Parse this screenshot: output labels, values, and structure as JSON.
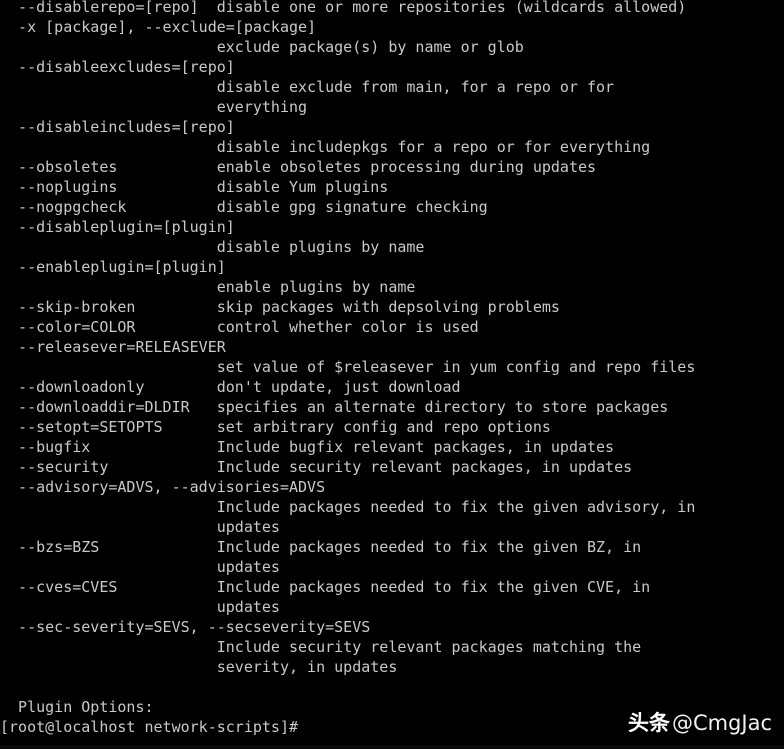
{
  "terminal": {
    "colors": {
      "background": "#000000",
      "foreground": "#c9c9c9",
      "watermark": "#ffffff"
    },
    "lines": [
      "  --disablerepo=[repo]  disable one or more repositories (wildcards allowed)",
      "  -x [package], --exclude=[package]",
      "                        exclude package(s) by name or glob",
      "  --disableexcludes=[repo]",
      "                        disable exclude from main, for a repo or for",
      "                        everything",
      "  --disableincludes=[repo]",
      "                        disable includepkgs for a repo or for everything",
      "  --obsoletes           enable obsoletes processing during updates",
      "  --noplugins           disable Yum plugins",
      "  --nogpgcheck          disable gpg signature checking",
      "  --disableplugin=[plugin]",
      "                        disable plugins by name",
      "  --enableplugin=[plugin]",
      "                        enable plugins by name",
      "  --skip-broken         skip packages with depsolving problems",
      "  --color=COLOR         control whether color is used",
      "  --releasever=RELEASEVER",
      "                        set value of $releasever in yum config and repo files",
      "  --downloadonly        don't update, just download",
      "  --downloaddir=DLDIR   specifies an alternate directory to store packages",
      "  --setopt=SETOPTS      set arbitrary config and repo options",
      "  --bugfix              Include bugfix relevant packages, in updates",
      "  --security            Include security relevant packages, in updates",
      "  --advisory=ADVS, --advisories=ADVS",
      "                        Include packages needed to fix the given advisory, in",
      "                        updates",
      "  --bzs=BZS             Include packages needed to fix the given BZ, in",
      "                        updates",
      "  --cves=CVES           Include packages needed to fix the given CVE, in",
      "                        updates",
      "  --sec-severity=SEVS, --secseverity=SEVS",
      "                        Include security relevant packages matching the",
      "                        severity, in updates",
      "",
      "  Plugin Options:",
      "[root@localhost network-scripts]#"
    ],
    "prompt": {
      "user": "root",
      "host": "localhost",
      "cwd": "network-scripts",
      "symbol": "#",
      "full": "[root@localhost network-scripts]#"
    },
    "section_heading": "Plugin Options:"
  },
  "watermark": {
    "logo": "头条",
    "handle": "@CmgJac"
  }
}
